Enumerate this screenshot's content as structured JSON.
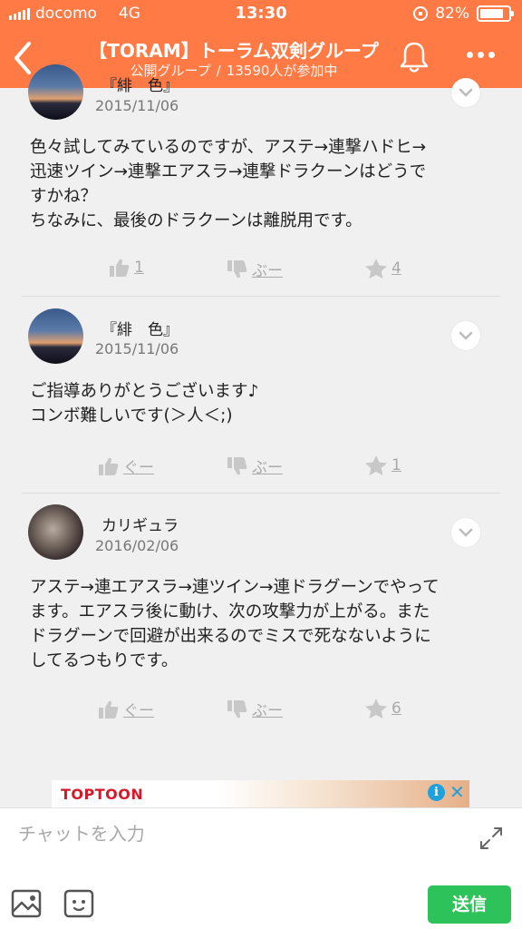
{
  "status_bar": {
    "carrier": "docomo",
    "network": "4G",
    "time": "13:30",
    "battery": "82%",
    "battery_level": 0.82
  },
  "nav": {
    "title": "【TORAM】トーラム双剣グループ",
    "subtitle_type": "公開グループ",
    "subtitle_sep": "/",
    "subtitle_members": "13590人が参加中"
  },
  "posts": [
    {
      "author": "『緋　色』",
      "date": "2015/11/06",
      "text": "色々試してみているのですが、アステ→連撃ハドヒ→\n迅速ツイン→連撃エアスラ→連撃ドラクーンはどうで\nすかね？\nちなみに、最後のドラクーンは離脱用です。",
      "like": "1",
      "dislike": "ぶー",
      "star": "4"
    },
    {
      "author": "『緋　色』",
      "date": "2015/11/06",
      "text": "ご指導ありがとうございます♪\nコンボ難しいです(＞人＜;)",
      "like": "ぐー",
      "dislike": "ぶー",
      "star": "1"
    },
    {
      "author": "カリギュラ",
      "date": "2016/02/06",
      "text": "アステ→連エアスラ→連ツイン→連ドラグーンでやって\nます。エアスラ後に動け、次の攻撃力が上がる。また\nドラグーンで回避が出来るのでミスで死なないように\nしてるつもりです。",
      "like": "ぐー",
      "dislike": "ぶー",
      "star": "6"
    }
  ],
  "ad": {
    "brand": "TOPTOON",
    "info": "i",
    "close": "✕"
  },
  "input": {
    "placeholder": "チャットを入力",
    "send_label": "送信"
  },
  "colors": {
    "header": "#ff7a45",
    "send": "#2ec25a",
    "ad_info": "#1ea1dc"
  }
}
